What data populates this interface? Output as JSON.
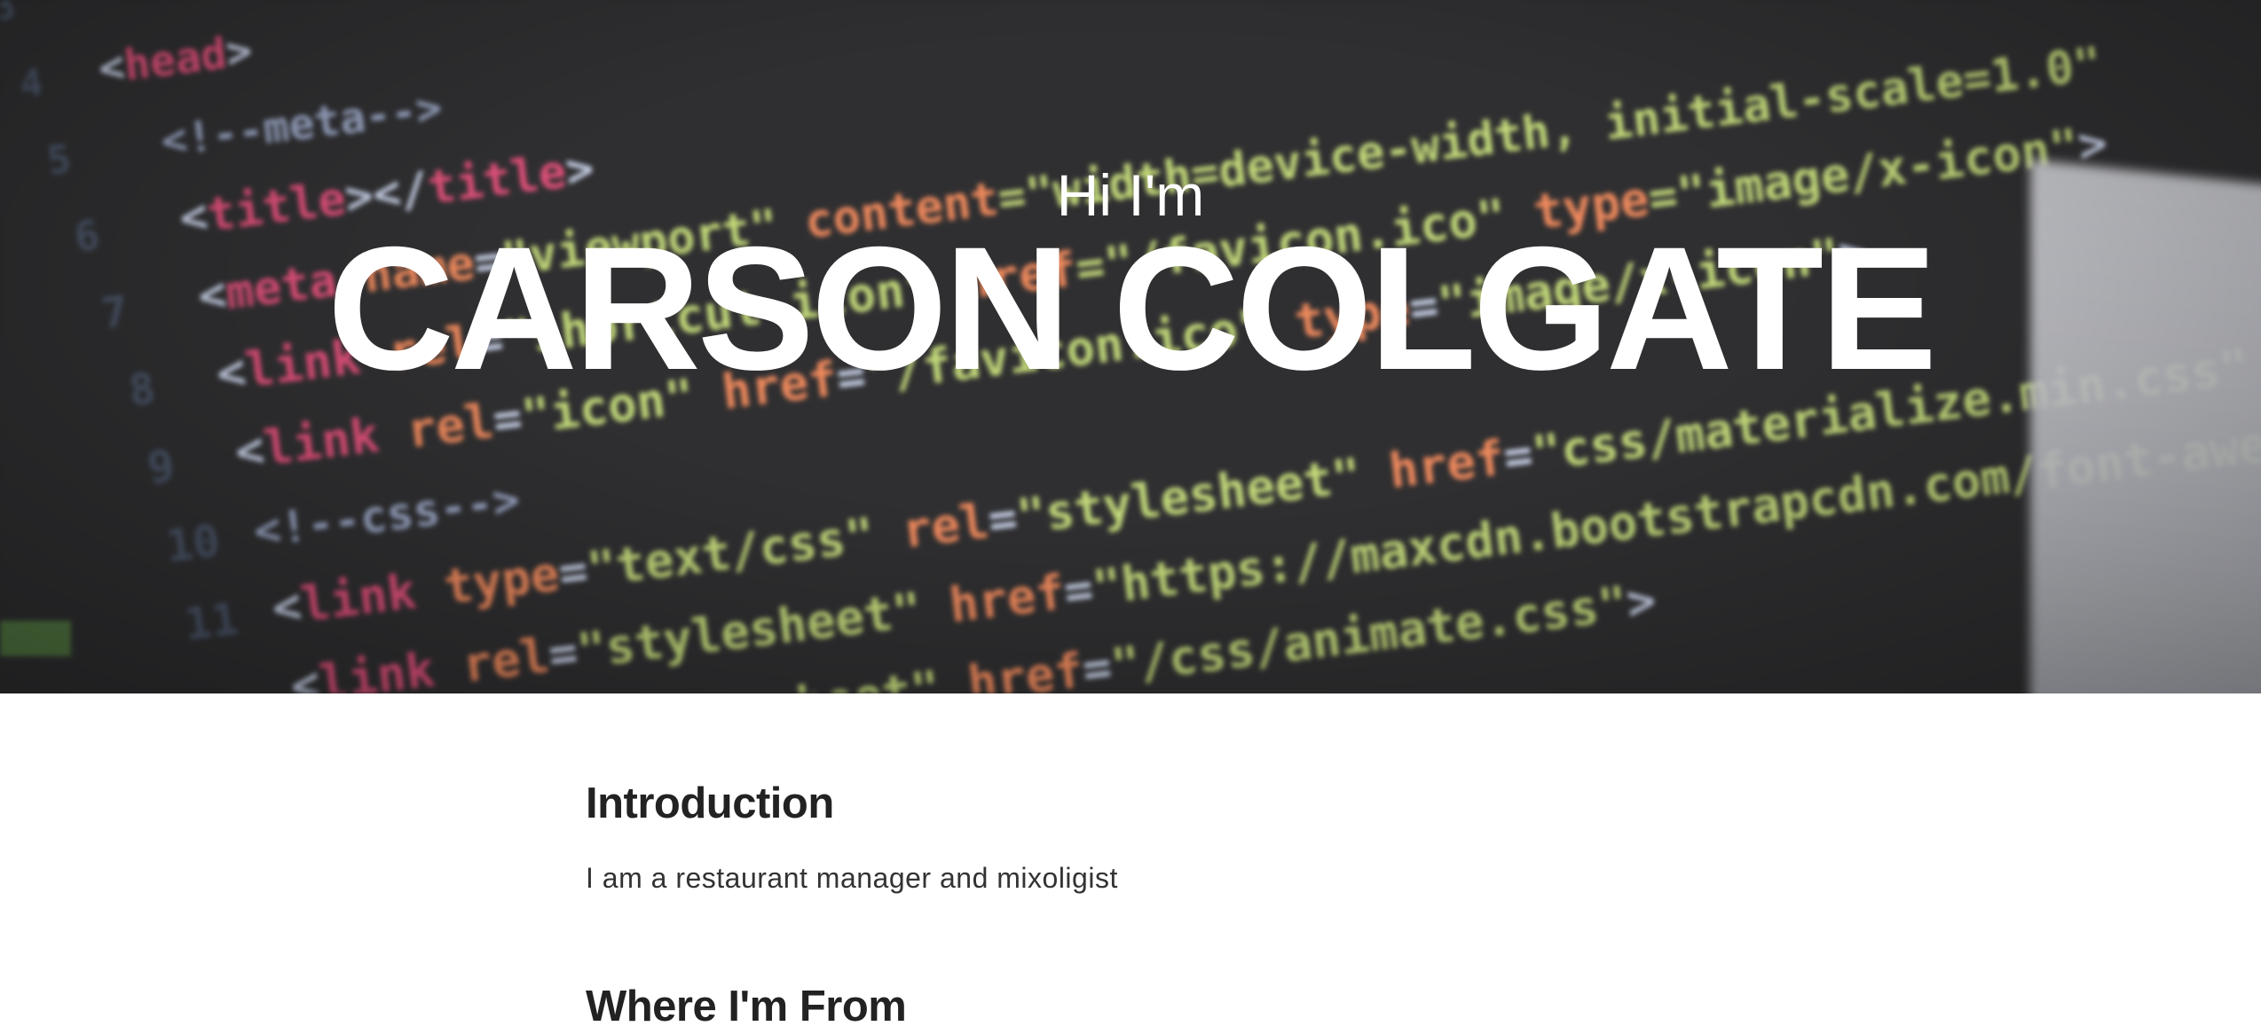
{
  "hero": {
    "greeting": "Hi I'm",
    "name": "CARSON COLGATE"
  },
  "sections": {
    "introduction": {
      "heading": "Introduction",
      "text": "I am a restaurant manager and mixoligist"
    },
    "origin": {
      "heading": "Where I'm From"
    }
  },
  "colors": {
    "hero_background": "#2f2f31",
    "heading_text": "#222222",
    "body_text": "#333333"
  }
}
